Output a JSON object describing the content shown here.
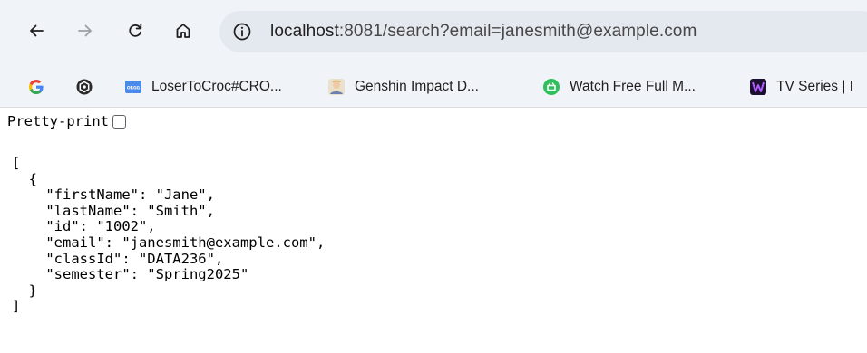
{
  "toolbar": {
    "back_icon": "arrow-left-icon",
    "forward_icon": "arrow-right-icon",
    "reload_icon": "reload-icon",
    "home_icon": "home-icon",
    "info_icon": "info-icon",
    "url_host": "localhost",
    "url_rest": ":8081/search?email=janesmith@example.com"
  },
  "bookmarks": [
    {
      "icon": "google-icon",
      "label": ""
    },
    {
      "icon": "openai-icon",
      "label": ""
    },
    {
      "icon": "oracle-icon",
      "label": "LoserToCroc#CRO..."
    },
    {
      "icon": "genshin-icon",
      "label": "Genshin Impact D..."
    },
    {
      "icon": "watch-icon",
      "label": "Watch Free Full M..."
    },
    {
      "icon": "tvseries-icon",
      "label": "TV Series | I"
    }
  ],
  "page": {
    "pretty_print_label": "Pretty-print",
    "pretty_print_checked": false,
    "json_text": "[\n  {\n    \"firstName\": \"Jane\",\n    \"lastName\": \"Smith\",\n    \"id\": \"1002\",\n    \"email\": \"janesmith@example.com\",\n    \"classId\": \"DATA236\",\n    \"semester\": \"Spring2025\"\n  }\n]"
  }
}
